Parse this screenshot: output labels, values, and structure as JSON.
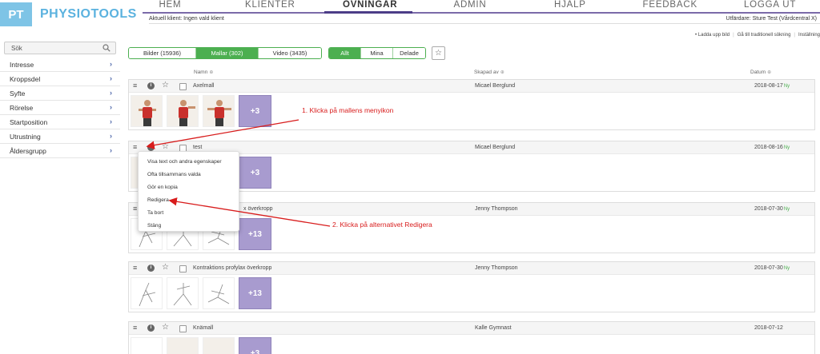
{
  "app": {
    "logo_mark": "PT",
    "logo_text": "PHYSIOTOOLS"
  },
  "nav": [
    {
      "label": "HEM",
      "active": false
    },
    {
      "label": "KLIENTER",
      "active": false
    },
    {
      "label": "ÖVNINGAR",
      "active": true
    },
    {
      "label": "ADMIN",
      "active": false
    },
    {
      "label": "HJÄLP",
      "active": false
    },
    {
      "label": "FEEDBACK",
      "active": false
    },
    {
      "label": "LOGGA UT",
      "active": false
    }
  ],
  "client_status": "Aktuell klient: Ingen vald klient",
  "issuer": "Utfärdare: Sture Test (Vårdcentral X)",
  "top_links": [
    "• Ladda upp bild",
    "Gå till traditionell sökning",
    "Inställning"
  ],
  "sidebar": {
    "search_label": "Sök",
    "items": [
      {
        "label": "Intresse"
      },
      {
        "label": "Kroppsdel"
      },
      {
        "label": "Syfte"
      },
      {
        "label": "Rörelse"
      },
      {
        "label": "Startposition"
      },
      {
        "label": "Utrustning"
      },
      {
        "label": "Åldersgrupp"
      }
    ],
    "chevron": "›"
  },
  "toolbar": {
    "types": [
      "Bilder (15936)",
      "Mallar (302)",
      "Video (3435)"
    ],
    "selected_type": "Mallar (302)",
    "filters": [
      "Allt",
      "Mina",
      "Delade"
    ],
    "selected_filter": "Allt",
    "favorite_glyph": "☆"
  },
  "columns": {
    "name": "Namn",
    "created_by": "Skapad av",
    "date": "Datum"
  },
  "templates": [
    {
      "name": "Axelmall",
      "creator": "Micael Berglund",
      "date": "2018-08-17",
      "new": "Ny",
      "more": "+3"
    },
    {
      "name": "test",
      "creator": "Micael Berglund",
      "date": "2018-08-16",
      "new": "Ny",
      "more": "+3"
    },
    {
      "name": "x överkropp",
      "creator": "Jenny Thompson",
      "date": "2018-07-30",
      "new": "Ny",
      "more": "+13"
    },
    {
      "name": "Kontraktions profylax överkropp",
      "creator": "Jenny Thompson",
      "date": "2018-07-30",
      "new": "Ny",
      "more": "+13"
    },
    {
      "name": "Knämall",
      "creator": "Kalle Gymnast",
      "date": "2018-07-12",
      "new": "",
      "more": "+3"
    }
  ],
  "card_icons": {
    "menu": "≡",
    "info": "i",
    "favorite": "☆"
  },
  "dropdown": [
    "Visa text och andra egenskaper",
    "Ofta tillsammans valda",
    "Gör en kopia",
    "Redigera",
    "Ta bort",
    "Stäng"
  ],
  "annotations": {
    "step1": "1. Klicka på mallens menyikon",
    "step2": "2. Klicka på alternativet Redigera"
  },
  "colors": {
    "accent_purple": "#4c3d87",
    "green": "#4caf50",
    "annotation_red": "#d81c1c",
    "more_tile": "#a89bcf"
  }
}
